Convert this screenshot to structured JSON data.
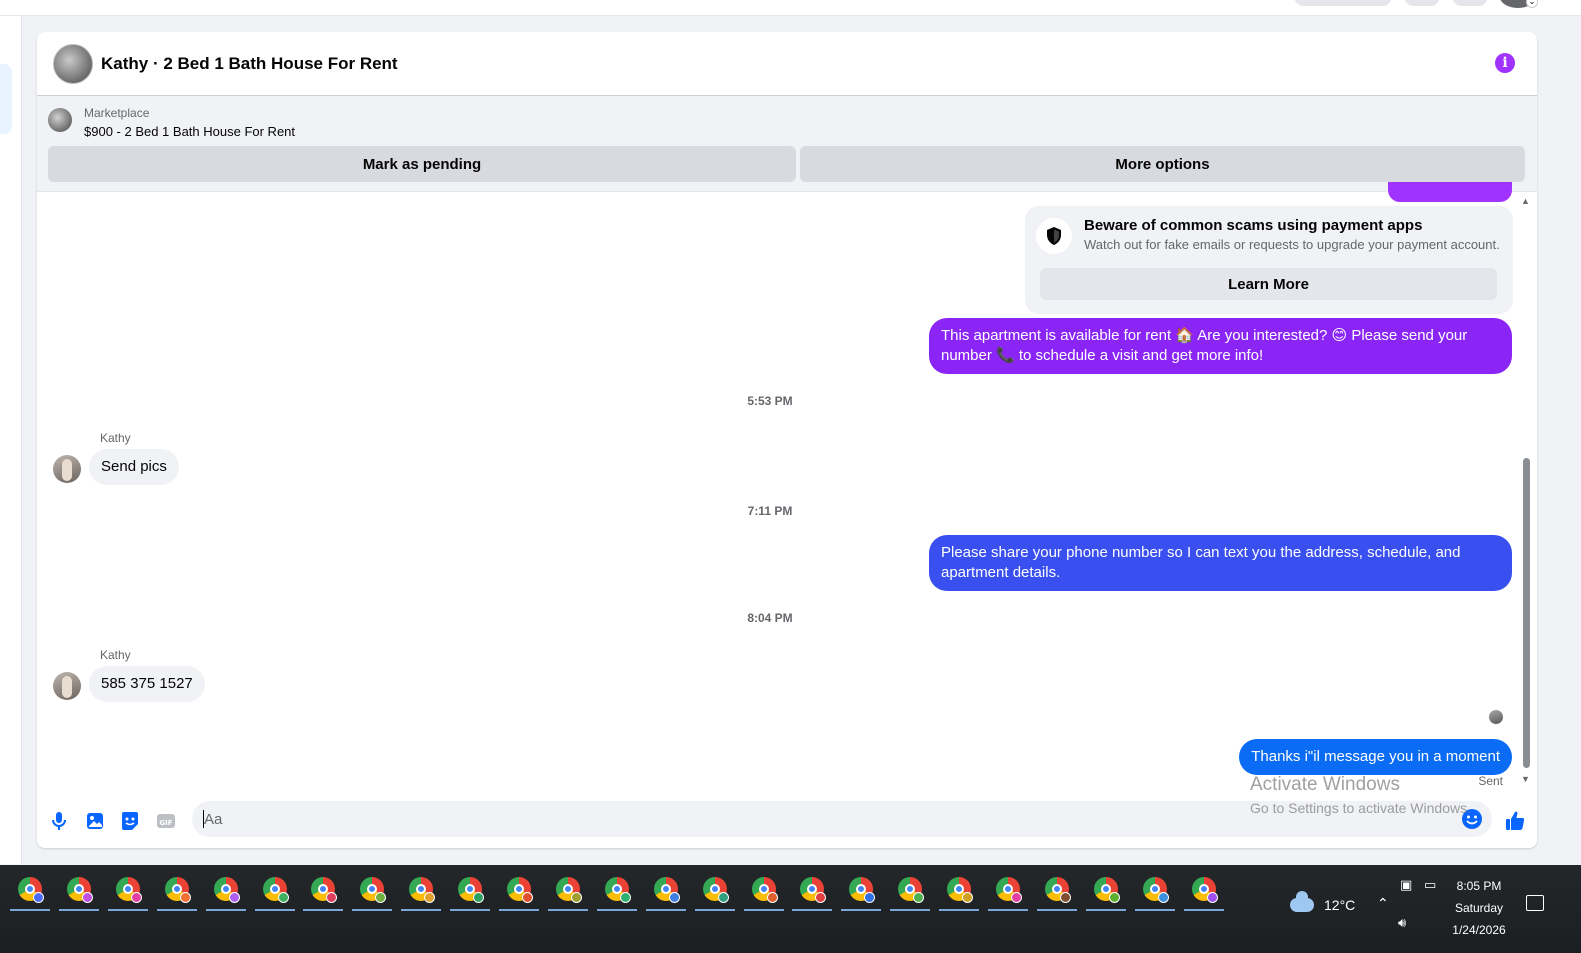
{
  "chat": {
    "title": "Kathy · 2 Bed 1 Bath House For Rent",
    "listing": {
      "label": "Marketplace",
      "title": "$900 - 2 Bed 1 Bath House For Rent",
      "pending_button": "Mark as pending",
      "more_button": "More options"
    },
    "scam_notice": {
      "title": "Beware of common scams using payment apps",
      "text": "Watch out for fake emails or requests to upgrade your payment account.",
      "button": "Learn More"
    },
    "messages": {
      "out1": "This apartment is available for rent 🏠 Are you interested? 😊 Please send your number 📞 to schedule a visit and get more info!",
      "time1": "5:53 PM",
      "sender1": "Kathy",
      "in1": "Send pics",
      "time2": "7:11 PM",
      "out2": "Please share your phone number so I can text you the address, schedule, and apartment details.",
      "time3": "8:04 PM",
      "sender2": "Kathy",
      "in2": "585 375 1527",
      "out3": "Thanks i\"il message you in a moment",
      "status": "Sent"
    },
    "composer": {
      "placeholder": "Aa"
    }
  },
  "watermark": {
    "line1": "Activate Windows",
    "line2": "Go to Settings to activate Windows."
  },
  "taskbar": {
    "apps": [
      {
        "badge": "#4a6cf7"
      },
      {
        "badge": "#c050e0"
      },
      {
        "badge": "#e040a0"
      },
      {
        "badge": "#f07030"
      },
      {
        "badge": "#b060f0"
      },
      {
        "badge": "#40b060"
      },
      {
        "badge": "#e04060"
      },
      {
        "badge": "#70b040"
      },
      {
        "badge": "#e0a030"
      },
      {
        "badge": "#30a060"
      },
      {
        "badge": "#e05030"
      },
      {
        "badge": "#a0a030"
      },
      {
        "badge": "#30b070"
      },
      {
        "badge": "#4080e0"
      },
      {
        "badge": "#30a080"
      },
      {
        "badge": "#e06030"
      },
      {
        "badge": "#e04040"
      },
      {
        "badge": "#3070e0"
      },
      {
        "badge": "#50b050"
      },
      {
        "badge": "#d0a020"
      },
      {
        "badge": "#e040a0"
      },
      {
        "badge": "#805030"
      },
      {
        "badge": "#60b030"
      },
      {
        "badge": "#4090e0"
      },
      {
        "badge": "#a050f0"
      }
    ],
    "weather": "12°C",
    "time": "8:05 PM",
    "day": "Saturday",
    "date": "1/24/2026"
  }
}
